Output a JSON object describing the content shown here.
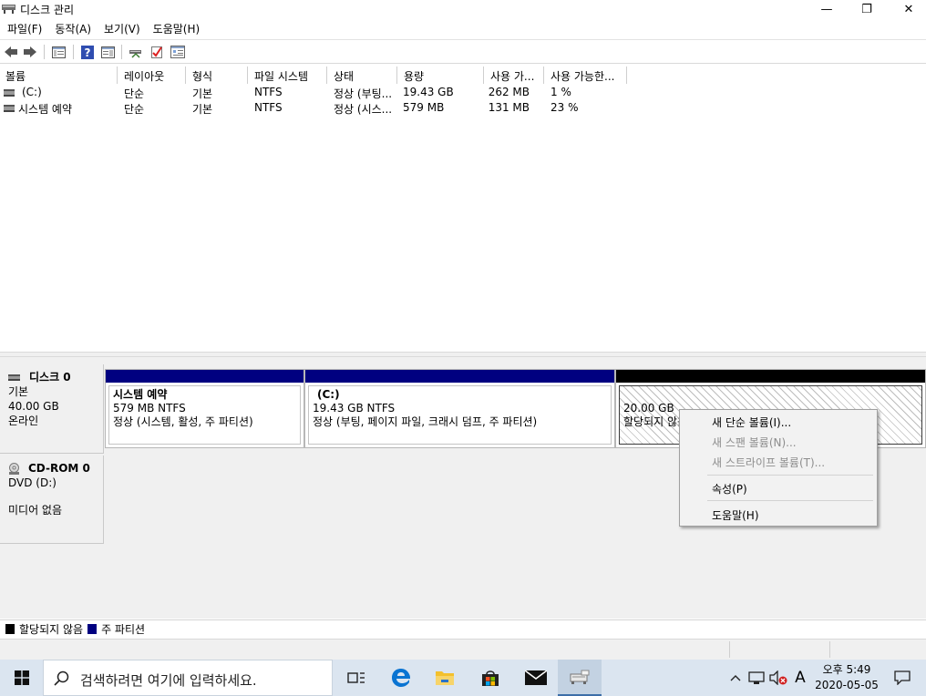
{
  "window": {
    "title": "디스크 관리",
    "buttons": {
      "minimize": "—",
      "restore": "❐",
      "close": "✕"
    }
  },
  "menu": {
    "items": [
      {
        "label": "파일(F)"
      },
      {
        "label": "동작(A)"
      },
      {
        "label": "보기(V)"
      },
      {
        "label": "도움말(H)"
      }
    ]
  },
  "volume_list": {
    "columns": [
      "볼륨",
      "레이아웃",
      "형식",
      "파일 시스템",
      "상태",
      "용량",
      "사용 가...",
      "사용 가능한..."
    ],
    "rows": [
      {
        "volume": "(C:)",
        "layout": "단순",
        "type": "기본",
        "fs": "NTFS",
        "status": "정상 (부팅...",
        "capacity": "19.43 GB",
        "free": "262 MB",
        "pct_free": "1 %"
      },
      {
        "volume": "시스템 예약",
        "layout": "단순",
        "type": "기본",
        "fs": "NTFS",
        "status": "정상 (시스...",
        "capacity": "579 MB",
        "free": "131 MB",
        "pct_free": "23 %"
      }
    ]
  },
  "disks": {
    "disk0": {
      "name": "디스크 0",
      "type": "기본",
      "size": "40.00 GB",
      "state": "온라인",
      "partitions": [
        {
          "name": "시스템 예약",
          "size": "579 MB NTFS",
          "status": "정상 (시스템, 활성, 주 파티션)"
        },
        {
          "name": "(C:)",
          "size": "19.43 GB NTFS",
          "status": "정상 (부팅, 페이지 파일, 크래시 덤프, 주 파티션)"
        },
        {
          "name": "",
          "size": "20.00 GB",
          "status": "할당되지 않음"
        }
      ]
    },
    "cdrom0": {
      "name": "CD-ROM 0",
      "drive": "DVD (D:)",
      "media": "미디어 없음"
    }
  },
  "legend": {
    "unallocated": "할당되지 않음",
    "primary": "주 파티션",
    "colors": {
      "unallocated": "#000000",
      "primary": "#000080"
    }
  },
  "context_menu": {
    "items": [
      {
        "label": "새 단순 볼륨(I)...",
        "enabled": true
      },
      {
        "label": "새 스팬 볼륨(N)...",
        "enabled": false
      },
      {
        "label": "새 스트라이프 볼륨(T)...",
        "enabled": false
      },
      {
        "label": "속성(P)",
        "enabled": true
      },
      {
        "label": "도움말(H)",
        "enabled": true
      }
    ]
  },
  "taskbar": {
    "search_placeholder": "검색하려면 여기에 입력하세요.",
    "apps": [
      "task-view-icon",
      "edge-icon",
      "file-explorer-icon",
      "store-icon",
      "mail-icon",
      "disk-management-icon"
    ],
    "tray": {
      "ime": "A"
    },
    "clock": {
      "time": "오후 5:49",
      "date": "2020-05-05"
    }
  }
}
